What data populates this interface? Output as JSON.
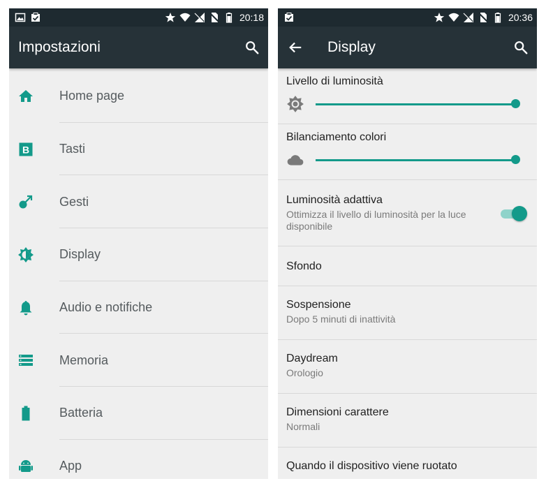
{
  "left": {
    "status": {
      "time": "20:18"
    },
    "appbar": {
      "title": "Impostazioni"
    },
    "items": [
      {
        "label": "Home page",
        "icon": "home-icon"
      },
      {
        "label": "Tasti",
        "icon": "buttons-icon"
      },
      {
        "label": "Gesti",
        "icon": "gesture-icon"
      },
      {
        "label": "Display",
        "icon": "brightness-icon"
      },
      {
        "label": "Audio e notifiche",
        "icon": "bell-icon"
      },
      {
        "label": "Memoria",
        "icon": "storage-icon"
      },
      {
        "label": "Batteria",
        "icon": "battery-icon"
      },
      {
        "label": "App",
        "icon": "android-icon"
      }
    ]
  },
  "right": {
    "status": {
      "time": "20:36"
    },
    "appbar": {
      "title": "Display"
    },
    "brightness": {
      "title": "Livello di luminosità",
      "value": 1.0
    },
    "color_balance": {
      "title": "Bilanciamento colori",
      "value": 1.0
    },
    "adaptive": {
      "title": "Luminosità adattiva",
      "subtitle": "Ottimizza il livello di luminosità per la luce disponibile",
      "enabled": true
    },
    "wallpaper": {
      "title": "Sfondo"
    },
    "sleep": {
      "title": "Sospensione",
      "subtitle": "Dopo 5 minuti di inattività"
    },
    "daydream": {
      "title": "Daydream",
      "subtitle": "Orologio"
    },
    "font_size": {
      "title": "Dimensioni carattere",
      "subtitle": "Normali"
    },
    "rotation": {
      "title": "Quando il dispositivo viene ruotato"
    }
  },
  "colors": {
    "accent": "#139a8a",
    "appbar": "#263238",
    "statusbar": "#1e2a30",
    "background": "#efefef"
  }
}
